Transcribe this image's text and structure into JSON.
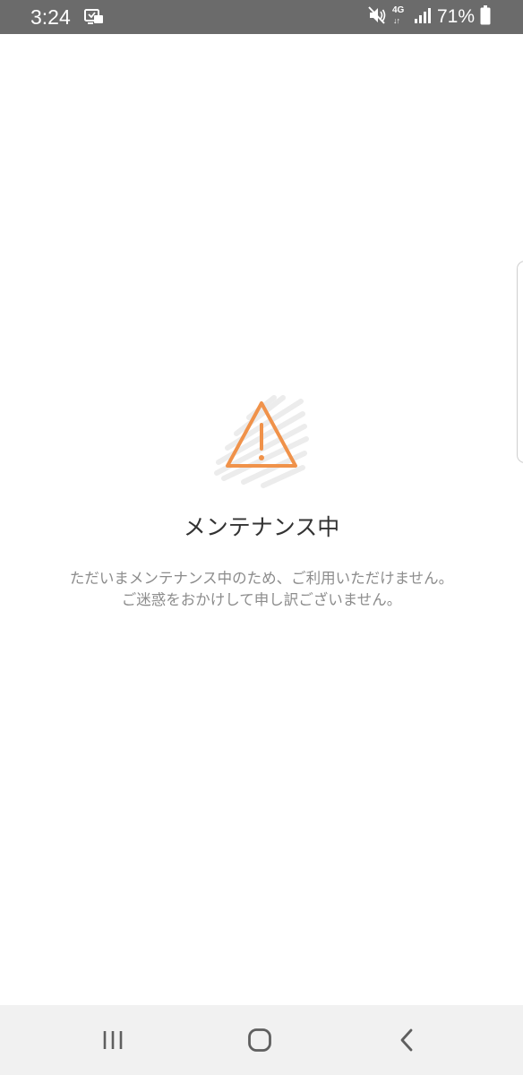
{
  "status_bar": {
    "time": "3:24",
    "network": "4G",
    "network_arrows": "↓↑",
    "battery": "71%",
    "icons": [
      "notification-icon",
      "mute-vibrate-icon",
      "network-4g-icon",
      "signal-icon",
      "battery-icon"
    ]
  },
  "maintenance": {
    "icon": "warning-icon",
    "accent_color": "#f0924a",
    "title": "メンテナンス中",
    "message_line1": "ただいまメンテナンス中のため、ご利用いただけません。",
    "message_line2": "ご迷惑をおかけして申し訳ございません。"
  },
  "nav_bar": {
    "buttons": [
      "recent-apps-icon",
      "home-icon",
      "back-icon"
    ]
  }
}
